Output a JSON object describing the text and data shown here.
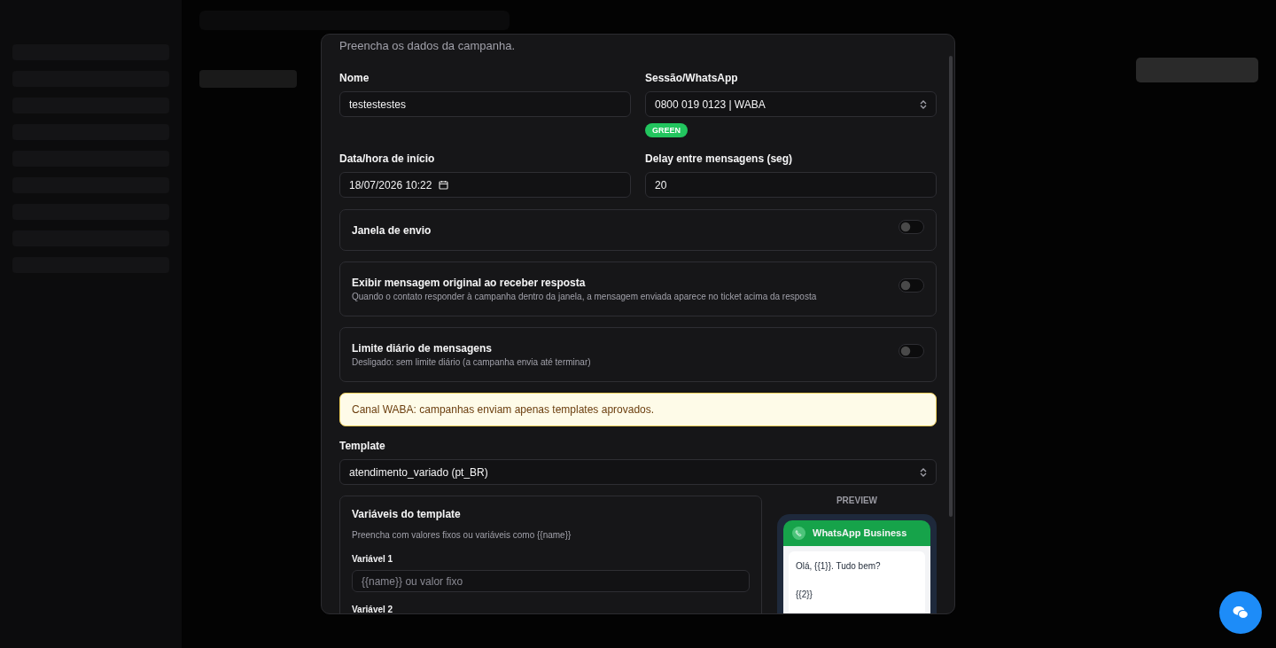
{
  "modal": {
    "subtitle": "Preencha os dados da campanha.",
    "name_field": {
      "label": "Nome",
      "value": "testestestes"
    },
    "session_field": {
      "label": "Sessão/WhatsApp",
      "value": "0800 019 0123 | WABA",
      "badge": "GREEN"
    },
    "start_field": {
      "label": "Data/hora de início",
      "value": "18/07/2026 10:22"
    },
    "delay_field": {
      "label": "Delay entre mensagens (seg)",
      "value": "20"
    },
    "toggles": [
      {
        "title": "Janela de envio",
        "on": false
      },
      {
        "title": "Exibir mensagem original ao receber resposta",
        "description": "Quando o contato responder à campanha dentro da janela, a mensagem enviada aparece no ticket acima da resposta",
        "on": false
      },
      {
        "title": "Limite diário de mensagens",
        "description": "Desligado: sem limite diário (a campanha envia até terminar)",
        "on": false
      }
    ],
    "alert": "Canal WABA: campanhas enviam apenas templates aprovados.",
    "template_field": {
      "label": "Template",
      "value": "atendimento_variado (pt_BR)"
    },
    "variables": {
      "title": "Variáveis do template",
      "hint": "Preencha com valores fixos ou variáveis como {{name}}",
      "items": [
        {
          "label": "Variável 1",
          "placeholder": "{{name}} ou valor fixo"
        },
        {
          "label": "Variável 2"
        }
      ]
    },
    "preview": {
      "label": "PREVIEW",
      "header": "WhatsApp Business",
      "lines": [
        "Olá, {{1}}. Tudo bem?",
        "{{2}}"
      ]
    }
  }
}
